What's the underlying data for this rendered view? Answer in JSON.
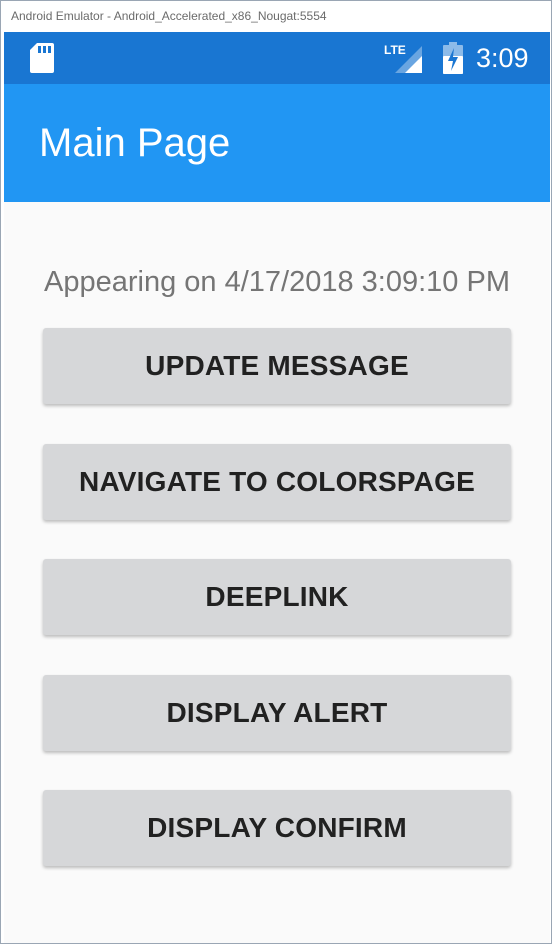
{
  "window": {
    "title": "Android Emulator - Android_Accelerated_x86_Nougat:5554"
  },
  "status_bar": {
    "left_icon": "sd-card-icon",
    "network_label": "LTE",
    "battery_icon": "battery-charging-icon",
    "time": "3:09",
    "color": "#1976d2"
  },
  "app_bar": {
    "title": "Main Page",
    "color": "#2196f3"
  },
  "main": {
    "message": "Appearing on 4/17/2018 3:09:10 PM",
    "buttons": [
      {
        "label": "UPDATE MESSAGE"
      },
      {
        "label": "NAVIGATE TO COLORSPAGE"
      },
      {
        "label": "DEEPLINK"
      },
      {
        "label": "DISPLAY ALERT"
      },
      {
        "label": "DISPLAY CONFIRM"
      }
    ]
  }
}
